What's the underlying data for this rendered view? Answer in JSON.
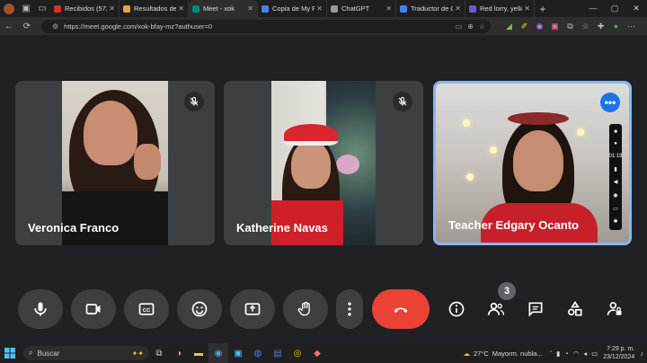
{
  "browser": {
    "tabs": [
      {
        "label": "Recibidos (572)",
        "color": "#d93025"
      },
      {
        "label": "Resultados de b",
        "color": "#e8a33d"
      },
      {
        "label": "Meet - xok",
        "color": "#00897b",
        "active": true
      },
      {
        "label": "Copia de My Fe",
        "color": "#4285f4"
      },
      {
        "label": "ChatGPT",
        "color": "#999999"
      },
      {
        "label": "Traductor de Go",
        "color": "#4285f4"
      },
      {
        "label": "Red lorry, yello",
        "color": "#6a5acd"
      }
    ],
    "url": "https://meet.google.com/xok-bfay-mz?authuser=0"
  },
  "participants": [
    {
      "name": "Veronica Franco",
      "muted": true
    },
    {
      "name": "Katherine Navas",
      "muted": true
    },
    {
      "name": "Teacher Edgary Ocanto",
      "muted": false
    }
  ],
  "side_panel": {
    "time": "01:19"
  },
  "controls": {
    "people_count": "3",
    "end_call_color": "#ea4335",
    "accent": "#1a73e8"
  },
  "taskbar": {
    "search_placeholder": "Buscar",
    "weather_temp": "27°C",
    "weather_desc": "Mayorm. nubla...",
    "time": "7:29 p. m.",
    "date": "23/12/2024"
  }
}
